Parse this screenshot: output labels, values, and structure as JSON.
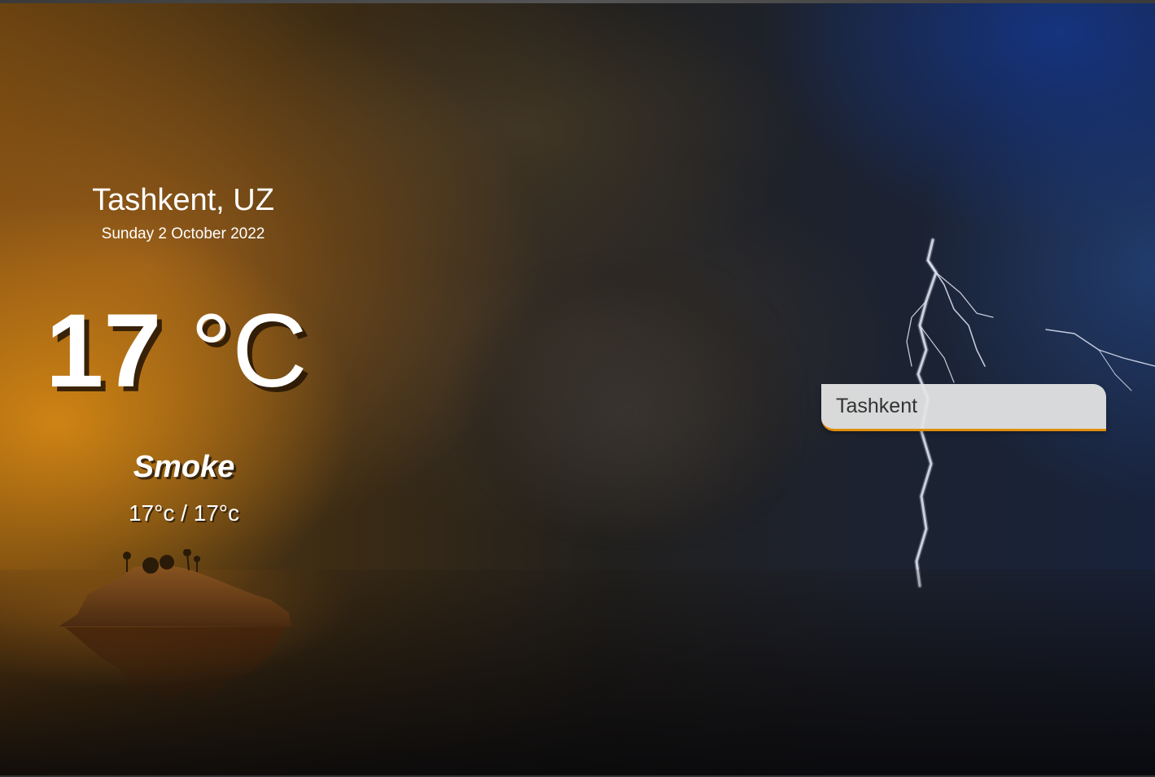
{
  "weather": {
    "location": "Tashkent, UZ",
    "date": "Sunday 2 October 2022",
    "temperature_value": "17",
    "temperature_unit": "°C",
    "condition": "Smoke",
    "hi_lo": "17°c / 17°c"
  },
  "search": {
    "value": "Tashkent"
  },
  "colors": {
    "accent": "#e08e0b",
    "search_background": "#e4e4e4",
    "text": "#ffffff"
  },
  "icons": {
    "background": "stormy-sea-island-background"
  }
}
